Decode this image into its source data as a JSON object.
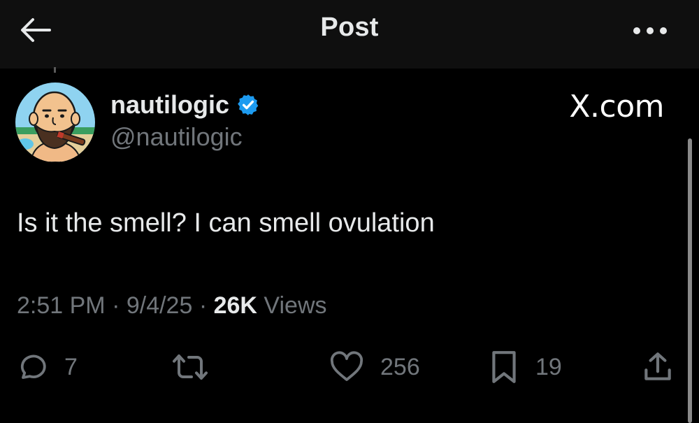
{
  "header": {
    "title": "Post",
    "back_icon": "arrow-left-icon",
    "more_icon": "more-horizontal-icon"
  },
  "author": {
    "display_name": "nautilogic",
    "handle": "@nautilogic",
    "verified": true,
    "verified_color": "#1d9bf0",
    "avatar_bg": "#e8d2ac"
  },
  "watermark": "X.com",
  "post": {
    "text": "Is it the smell? I can smell ovulation"
  },
  "meta": {
    "time": "2:51 PM",
    "sep1": " · ",
    "date": "9/4/25",
    "sep2": " · ",
    "views_count": "26K",
    "views_label": " Views"
  },
  "actions": {
    "replies": "7",
    "reposts": "",
    "likes": "256",
    "bookmarks": "19"
  },
  "colors": {
    "background": "#000000",
    "header_bg": "#0f0f0f",
    "primary_text": "#e7e9ea",
    "secondary_text": "#71767b",
    "accent": "#1d9bf0"
  }
}
